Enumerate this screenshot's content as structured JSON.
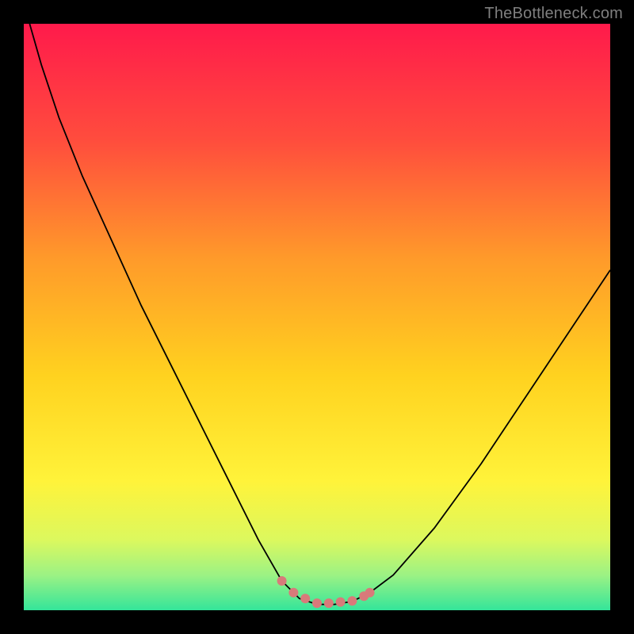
{
  "watermark": "TheBottleneck.com",
  "chart_data": {
    "type": "line",
    "title": "",
    "xlabel": "",
    "ylabel": "",
    "xlim": [
      0,
      100
    ],
    "ylim": [
      0,
      100
    ],
    "grid": false,
    "background_gradient_stops": [
      {
        "offset": 0.0,
        "color": "#ff1a4b"
      },
      {
        "offset": 0.2,
        "color": "#ff4d3d"
      },
      {
        "offset": 0.4,
        "color": "#ff9a2a"
      },
      {
        "offset": 0.6,
        "color": "#ffd21f"
      },
      {
        "offset": 0.78,
        "color": "#fff33a"
      },
      {
        "offset": 0.88,
        "color": "#dcf85e"
      },
      {
        "offset": 0.94,
        "color": "#9cf284"
      },
      {
        "offset": 1.0,
        "color": "#34e59a"
      }
    ],
    "series": [
      {
        "name": "bottleneck-curve",
        "color": "#000000",
        "width": 1.8,
        "x": [
          1,
          3,
          6,
          10,
          15,
          20,
          25,
          30,
          35,
          40,
          44,
          47,
          50,
          53,
          56,
          59,
          63,
          70,
          78,
          86,
          94,
          100
        ],
        "y": [
          100,
          93,
          84,
          74,
          63,
          52,
          42,
          32,
          22,
          12,
          5,
          2,
          1,
          1,
          1.5,
          3,
          6,
          14,
          25,
          37,
          49,
          58
        ]
      }
    ],
    "valley_marker": {
      "name": "optimal-range",
      "color": "#d87a7a",
      "radius": 6,
      "x": [
        44,
        46,
        48,
        50,
        52,
        54,
        56,
        58,
        59
      ],
      "y": [
        5,
        3,
        2,
        1.2,
        1.2,
        1.4,
        1.6,
        2.4,
        3
      ]
    }
  }
}
